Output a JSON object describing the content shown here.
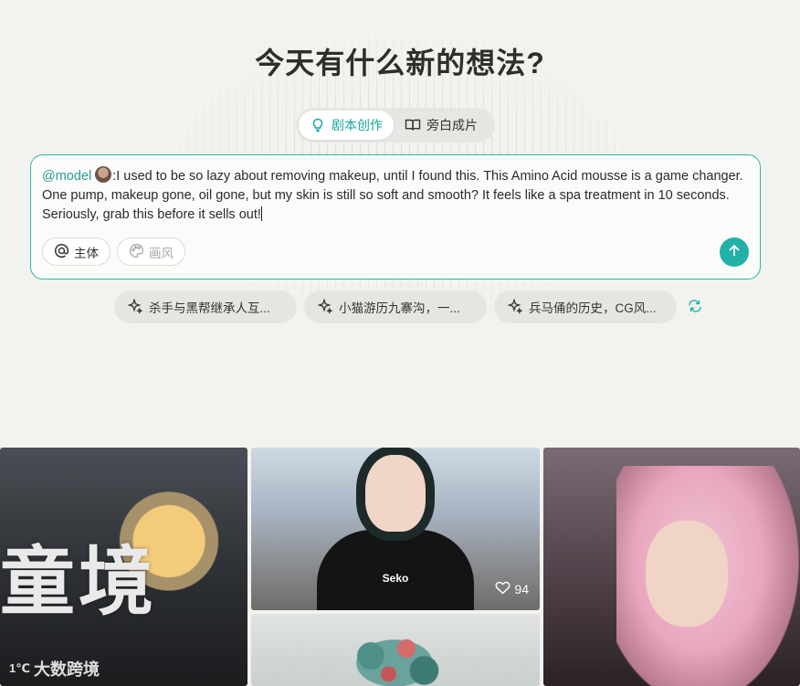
{
  "header": {
    "title": "今天有什么新的想法?"
  },
  "modes": [
    {
      "label": "剧本创作",
      "icon": "lightbulb-icon",
      "active": true
    },
    {
      "label": "旁白成片",
      "icon": "book-icon",
      "active": false
    }
  ],
  "prompt": {
    "mention": "@model",
    "text": ":I used to be so lazy about removing makeup, until I found this. This Amino Acid mousse is a game changer. One pump, makeup gone, oil gone, but my skin is still so soft and smooth? It feels like a spa treatment in 10 seconds. Seriously, grab this before it sells out!",
    "chips": [
      {
        "label": "主体",
        "icon": "at-icon"
      },
      {
        "label": "画风",
        "icon": "palette-icon"
      }
    ]
  },
  "suggestions": [
    {
      "label": "杀手与黑帮继承人互..."
    },
    {
      "label": "小猫游历九寨沟，一..."
    },
    {
      "label": "兵马俑的历史，CG风..."
    }
  ],
  "gallery": {
    "card1": {
      "overlay_text": "童境",
      "watermark": "大数跨境"
    },
    "card2": {
      "hoodie_text": "Seko",
      "likes": "94"
    }
  },
  "colors": {
    "accent": "#22b1a6",
    "background": "#f2f2ee"
  }
}
